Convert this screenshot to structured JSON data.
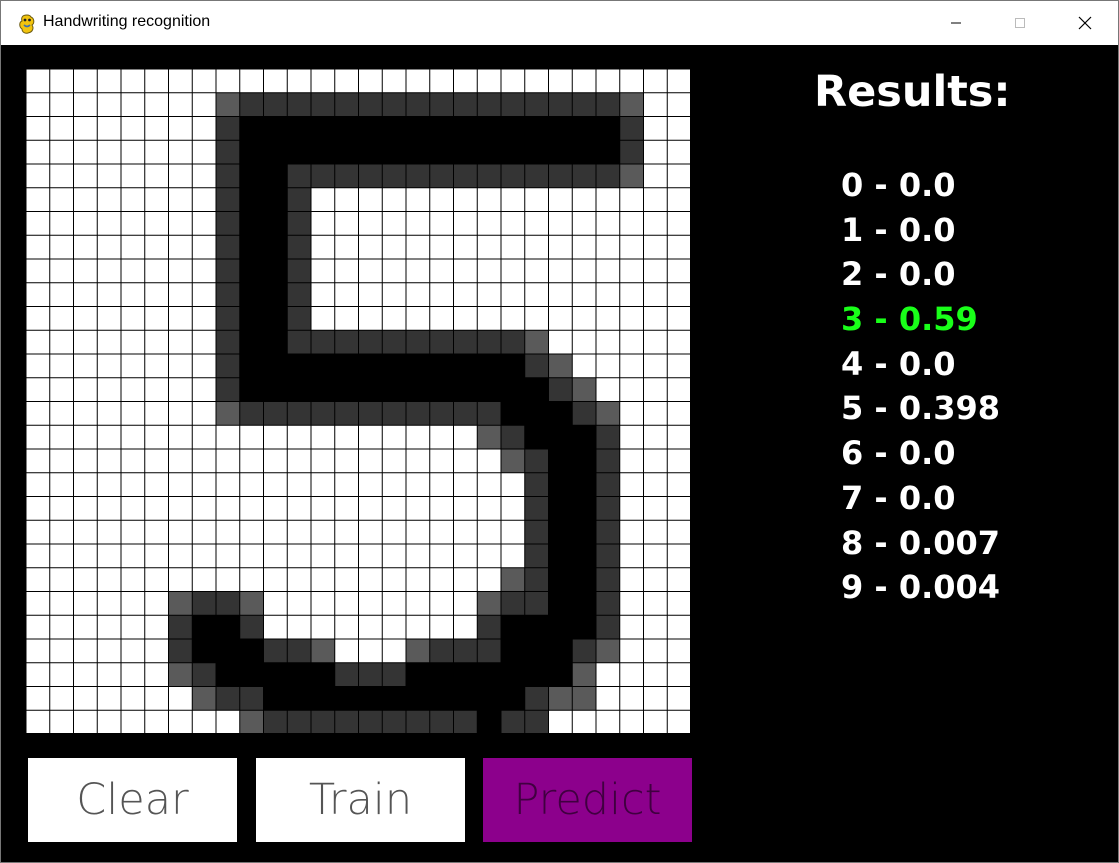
{
  "window": {
    "title": "Handwriting recognition",
    "app_icon": "pygame-snake-icon",
    "controls": [
      "minimize-icon",
      "maximize-icon",
      "close-icon"
    ]
  },
  "canvas": {
    "cols": 28,
    "rows": 28,
    "palette": {
      "0": "#ffffff",
      "1": "#5a5a5a",
      "2": "#343434",
      "3": "#000000",
      "grid_line": "#000000"
    },
    "pixels": [
      "0000000000000000000000000000",
      "0000000012222222222222222100",
      "0000000023333333333333333200",
      "0000000023333333333333333200",
      "0000000023322222222222222100",
      "0000000023320000000000000000",
      "0000000023320000000000000000",
      "0000000023320000000000000000",
      "0000000023320000000000000000",
      "0000000023320000000000000000",
      "0000000023320000000000000000",
      "0000000023322222222221000000",
      "0000000023333333333332100000",
      "0000000023333333333333210000",
      "0000000012222222222233321000",
      "0000000000000000000123332000",
      "0000000000000000000012332000",
      "0000000000000000000002332000",
      "0000000000000000000002332000",
      "0000000000000000000002332000",
      "0000000000000000000002332000",
      "0000000000000000000012332000",
      "0000001221000000000122332000",
      "0000002332000000000233332000",
      "0000002333221000122233321000",
      "0000001233333222333333310000",
      "0000000122333333333332110000",
      "0000000001222222222322000000"
    ]
  },
  "buttons": {
    "clear": "Clear",
    "train": "Train",
    "predict": "Predict"
  },
  "colors": {
    "predict_button": "#8c008c",
    "predict_text": "#400040",
    "highlight": "#19ff19",
    "results_text": "#ffffff",
    "background": "#000000"
  },
  "results": {
    "title": "Results:",
    "highlight_index": 3,
    "items": [
      "0 - 0.0",
      "1 - 0.0",
      "2 - 0.0",
      "3 - 0.59",
      "4 - 0.0",
      "5 - 0.398",
      "6 - 0.0",
      "7 - 0.0",
      "8 - 0.007",
      "9 - 0.004"
    ]
  }
}
